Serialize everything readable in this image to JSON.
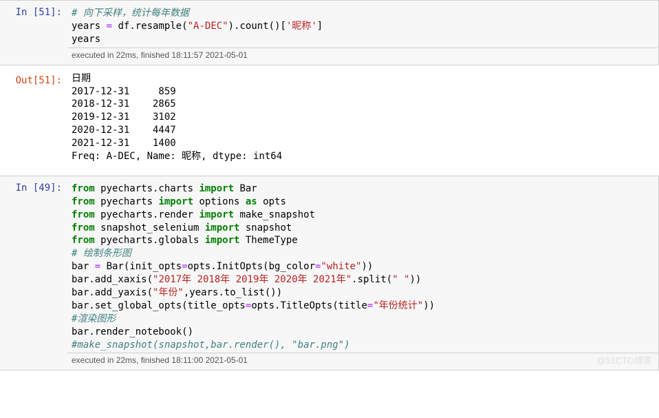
{
  "cells": [
    {
      "prompt": "In  [51]:",
      "type": "code",
      "code_html": "<span class='c-comment'># 向下采样，统计每年数据</span>\nyears <span class='c-op'>=</span> df<span class='c-punct'>.</span>resample(<span class='c-str'>&quot;A-DEC&quot;</span>)<span class='c-punct'>.</span>count()[<span class='c-str'>'昵称'</span>]\nyears",
      "exec": "executed in 22ms, finished 18:11:57 2021-05-01"
    },
    {
      "prompt": "Out[51]:",
      "type": "output",
      "output": "日期\n2017-12-31     859\n2018-12-31    2865\n2019-12-31    3102\n2020-12-31    4447\n2021-12-31    1400\nFreq: A-DEC, Name: 昵称, dtype: int64"
    },
    {
      "prompt": "In  [49]:",
      "type": "code",
      "code_html": "<span class='c-keyword'>from</span> pyecharts.charts <span class='c-keyword'>import</span> Bar\n<span class='c-keyword'>from</span> pyecharts <span class='c-keyword'>import</span> options <span class='c-keyword'>as</span> opts\n<span class='c-keyword'>from</span> pyecharts.render <span class='c-keyword'>import</span> make_snapshot\n<span class='c-keyword'>from</span> snapshot_selenium <span class='c-keyword'>import</span> snapshot\n<span class='c-keyword'>from</span> pyecharts.globals <span class='c-keyword'>import</span> ThemeType\n<span class='c-comment'># 绘制条形图</span>\nbar <span class='c-op'>=</span> Bar(init_opts<span class='c-op'>=</span>opts.InitOpts(bg_color<span class='c-op'>=</span><span class='c-str'>&quot;white&quot;</span>))\nbar.add_xaxis(<span class='c-str'>&quot;2017年 2018年 2019年 2020年 2021年&quot;</span>.split(<span class='c-str'>&quot; &quot;</span>))\nbar.add_yaxis(<span class='c-str'>&quot;年份&quot;</span>,years.to_list())\nbar.set_global_opts(title_opts<span class='c-op'>=</span>opts.TitleOpts(title<span class='c-op'>=</span><span class='c-str'>&quot;年份统计&quot;</span>))\n<span class='c-comment'>#渲染图形</span>\nbar.render_notebook()\n<span class='c-comment'>#make_snapshot(snapshot,bar.render(), &quot;bar.png&quot;)</span>",
      "exec": "executed in 22ms, finished 18:11:00 2021-05-01"
    }
  ],
  "watermark": "@51CTO博客"
}
